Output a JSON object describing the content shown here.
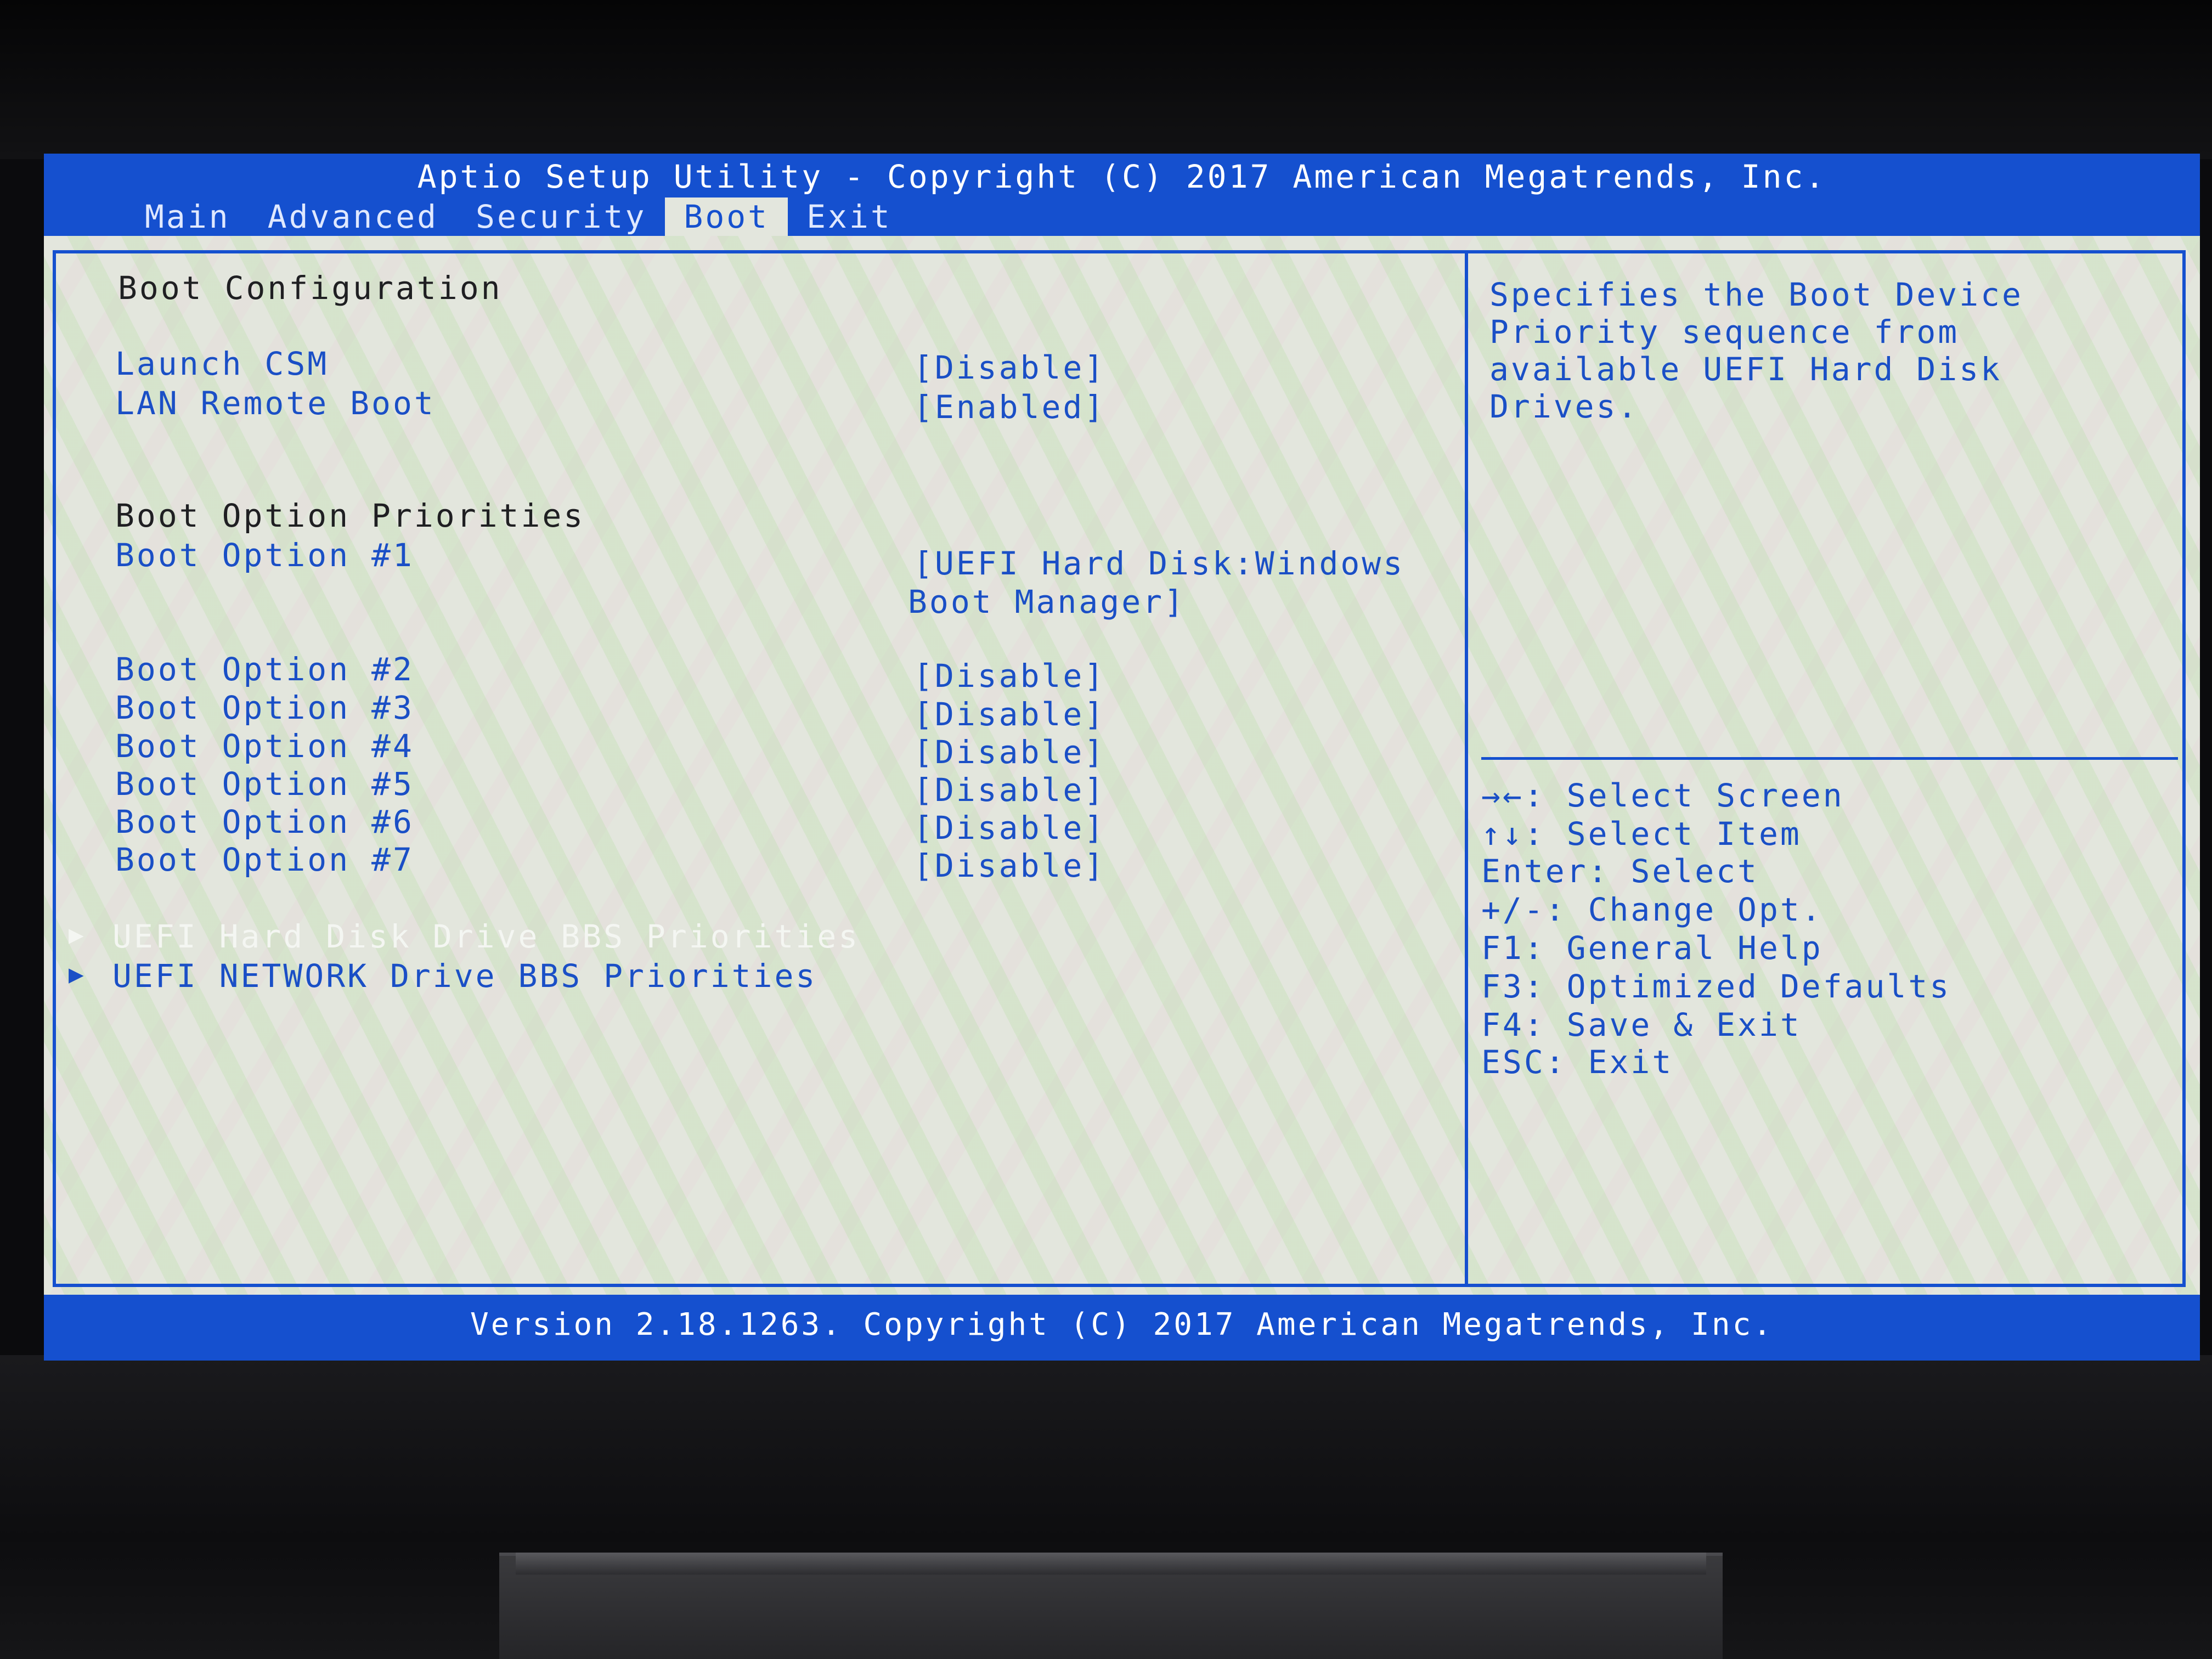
{
  "header": {
    "title": "Aptio Setup Utility - Copyright (C) 2017 American Megatrends, Inc."
  },
  "tabs": [
    {
      "label": "Main",
      "active": false
    },
    {
      "label": "Advanced",
      "active": false
    },
    {
      "label": "Security",
      "active": false
    },
    {
      "label": "Boot",
      "active": true
    },
    {
      "label": "Exit",
      "active": false
    }
  ],
  "main": {
    "section_boot_config": "Boot Configuration",
    "launch_csm": {
      "label": "Launch CSM",
      "value": "[Disable]"
    },
    "lan_remote_boot": {
      "label": "LAN Remote Boot",
      "value": "[Enabled]"
    },
    "section_priorities": "Boot Option Priorities",
    "boot_options": [
      {
        "label": "Boot Option #1",
        "value_line1": "[UEFI Hard Disk:Windows",
        "value_line2": "Boot Manager]"
      },
      {
        "label": "Boot Option #2",
        "value": "[Disable]"
      },
      {
        "label": "Boot Option #3",
        "value": "[Disable]"
      },
      {
        "label": "Boot Option #4",
        "value": "[Disable]"
      },
      {
        "label": "Boot Option #5",
        "value": "[Disable]"
      },
      {
        "label": "Boot Option #6",
        "value": "[Disable]"
      },
      {
        "label": "Boot Option #7",
        "value": "[Disable]"
      }
    ],
    "submenus": [
      {
        "label": "UEFI Hard Disk Drive BBS Priorities",
        "highlighted": true
      },
      {
        "label": "UEFI NETWORK Drive BBS Priorities",
        "highlighted": false
      }
    ],
    "submenu_arrow": "▶"
  },
  "help": {
    "lines": [
      "Specifies the Boot Device",
      "Priority sequence from",
      "available UEFI Hard Disk",
      "Drives."
    ]
  },
  "keys": [
    "→←: Select Screen",
    "↑↓: Select Item",
    "Enter: Select",
    "+/-: Change Opt.",
    "F1: General Help",
    "F3: Optimized Defaults",
    "F4: Save & Exit",
    "ESC: Exit"
  ],
  "footer": {
    "version": "Version 2.18.1263. Copyright (C) 2017 American Megatrends, Inc."
  },
  "colors": {
    "bios_blue": "#1550cf",
    "background": "#e3e6dd",
    "header_text": "#1f1f22"
  }
}
